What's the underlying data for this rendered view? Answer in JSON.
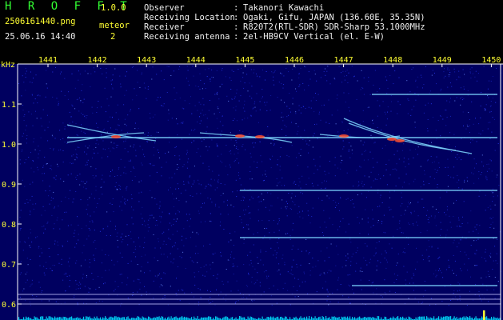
{
  "header": {
    "app_name": "H R O F F T",
    "version": "1.0.0",
    "filename": "2506161440.png",
    "datetime": "25.06.16 14:40",
    "event_label": "meteor",
    "event_count": "2",
    "fields": [
      {
        "label": "Observer",
        "sep": ":",
        "value": "Takanori Kawachi"
      },
      {
        "label": "Receiving Location",
        "sep": ":",
        "value": "Ogaki, Gifu, JAPAN (136.60E, 35.35N)"
      },
      {
        "label": "Receiver",
        "sep": ":",
        "value": "R820T2(RTL-SDR) SDR-Sharp 53.1000MHz"
      },
      {
        "label": "Receiving antenna",
        "sep": ":",
        "value": "2el-HB9CV Vertical (el. E-W)"
      }
    ]
  },
  "spectrogram": {
    "y_unit": "kHz",
    "x_ticks": [
      "1441",
      "1442",
      "1443",
      "1444",
      "1445",
      "1446",
      "1447",
      "1448",
      "1449",
      "1450"
    ],
    "y_ticks": [
      "1.1",
      "1.0",
      "0.9",
      "0.8",
      "0.7",
      "0.6"
    ],
    "colors": {
      "background": "#000060",
      "noise": "#2a3cff",
      "carrier": "#7fd8ff",
      "echo_hot": "#ff5030",
      "grid": "#c8c8ff",
      "baseline": "#00e0ff"
    }
  }
}
